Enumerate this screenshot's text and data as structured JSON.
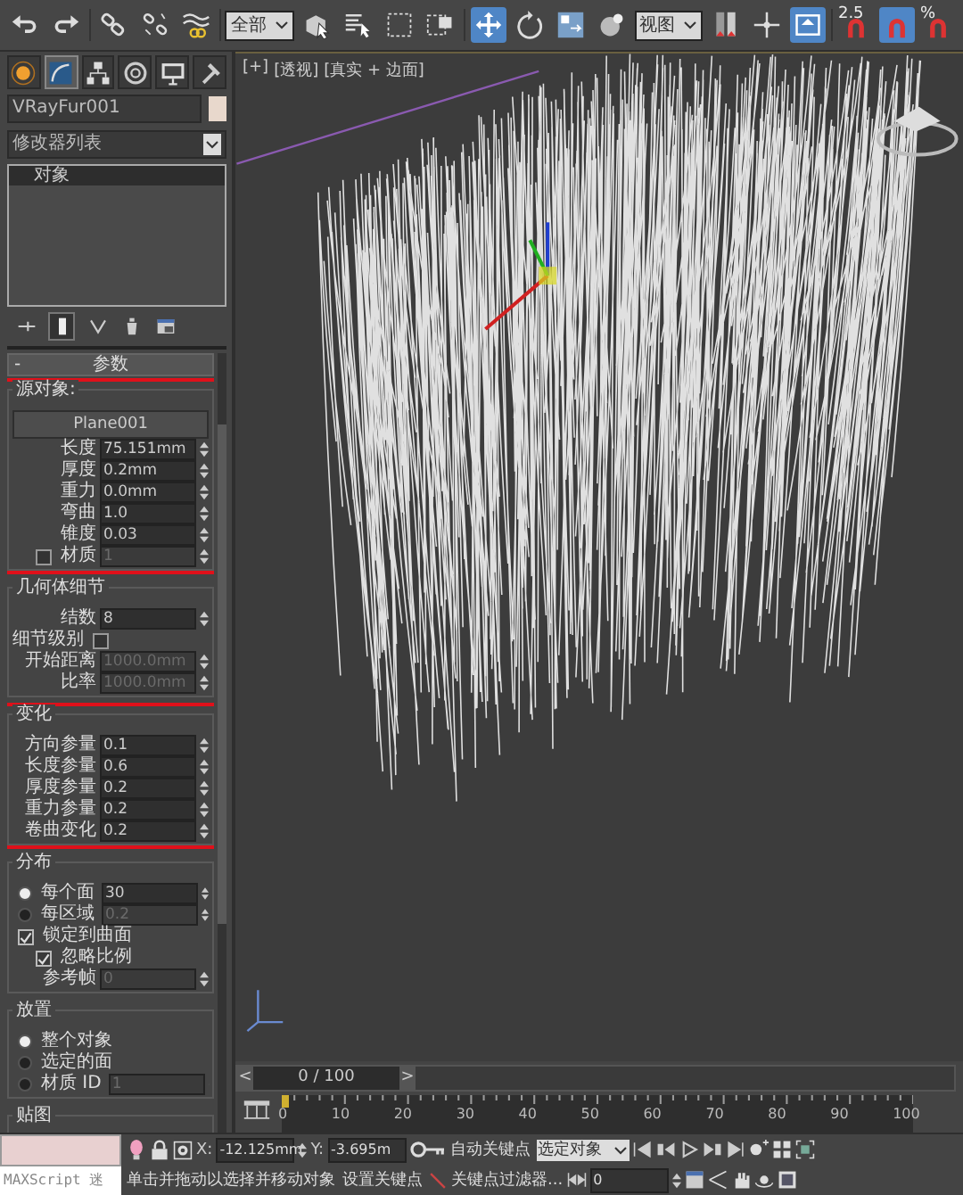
{
  "toolbar": [
    {
      "kind": "undo",
      "on": false
    },
    {
      "kind": "redo",
      "on": false
    },
    {
      "kind": "link",
      "on": false
    },
    {
      "kind": "unlink",
      "on": false
    },
    {
      "kind": "bind",
      "on": false
    },
    {
      "kind": "dropdown",
      "value": "全部"
    },
    {
      "kind": "select",
      "on": false
    },
    {
      "kind": "select-list",
      "on": false
    },
    {
      "kind": "region",
      "on": false
    },
    {
      "kind": "window",
      "on": false
    },
    {
      "kind": "move",
      "on": true
    },
    {
      "kind": "rotate",
      "on": false
    },
    {
      "kind": "scale",
      "on": false
    },
    {
      "kind": "sphere",
      "on": false
    },
    {
      "kind": "dropdown",
      "value": "视图"
    },
    {
      "kind": "mirror",
      "on": false
    },
    {
      "kind": "pivot",
      "on": false
    },
    {
      "kind": "snap",
      "on": true
    },
    {
      "kind": "magnet",
      "label": "2.5",
      "on": false
    },
    {
      "kind": "magnet",
      "on": true
    },
    {
      "kind": "magnet",
      "label": "%",
      "on": false
    }
  ],
  "command_tabs": [
    {
      "kind": "create",
      "selected": false
    },
    {
      "kind": "modify",
      "selected": true
    },
    {
      "kind": "hierarchy",
      "selected": false
    },
    {
      "kind": "motion",
      "selected": false
    },
    {
      "kind": "display",
      "selected": false
    },
    {
      "kind": "utilities",
      "selected": false
    }
  ],
  "object_name": "VRayFur001",
  "modifier_list": "修改器列表",
  "modifier_stack": [
    "对象"
  ],
  "stack_tools": [
    {
      "kind": "pin",
      "on": false
    },
    {
      "kind": "end-result",
      "on": true
    },
    {
      "kind": "unique",
      "on": false
    },
    {
      "kind": "remove",
      "on": false
    },
    {
      "kind": "configure",
      "on": false
    }
  ],
  "rollout": {
    "title": "参数",
    "collapse": "-"
  },
  "groups": [
    {
      "title": "源对象:",
      "highlighted": true,
      "rows": [
        {
          "kind": "button",
          "label": "Plane001"
        },
        {
          "kind": "spinner",
          "label": "长度",
          "value": "75.151mm",
          "disabled": false
        },
        {
          "kind": "spinner",
          "label": "厚度",
          "value": "0.2mm",
          "disabled": false
        },
        {
          "kind": "spinner",
          "label": "重力",
          "value": "0.0mm",
          "disabled": false
        },
        {
          "kind": "spinner",
          "label": "弯曲",
          "value": "1.0",
          "disabled": false
        },
        {
          "kind": "spinner",
          "label": "锥度",
          "value": "0.03",
          "disabled": false
        },
        {
          "kind": "check-spinner",
          "label": "材质",
          "value": "1",
          "checked": false,
          "disabled": true
        }
      ]
    },
    {
      "title": "几何体细节",
      "highlighted": false,
      "rows": [
        {
          "kind": "spinner",
          "label": "结数",
          "value": "8",
          "disabled": false
        },
        {
          "kind": "checkbox-right",
          "label": "细节级别",
          "checked": false
        },
        {
          "kind": "spinner",
          "label": "开始距离",
          "value": "1000.0mm",
          "disabled": true
        },
        {
          "kind": "spinner",
          "label": "比率",
          "value": "1000.0mm",
          "disabled": true
        }
      ]
    },
    {
      "title": "变化",
      "highlighted": true,
      "rows": [
        {
          "kind": "spinner",
          "label": "方向参量",
          "value": "0.1",
          "disabled": false
        },
        {
          "kind": "spinner",
          "label": "长度参量",
          "value": "0.6",
          "disabled": false
        },
        {
          "kind": "spinner",
          "label": "厚度参量",
          "value": "0.2",
          "disabled": false
        },
        {
          "kind": "spinner",
          "label": "重力参量",
          "value": "0.2",
          "disabled": false
        },
        {
          "kind": "spinner",
          "label": "卷曲变化",
          "value": "0.2",
          "disabled": false
        }
      ]
    },
    {
      "title": "分布",
      "highlighted": false,
      "rows": [
        {
          "kind": "radio-spinner",
          "label": "每个面",
          "value": "30",
          "selected": true,
          "disabled": false
        },
        {
          "kind": "radio-spinner",
          "label": "每区域",
          "value": "0.2",
          "selected": false,
          "disabled": true
        },
        {
          "kind": "checkbox",
          "label": "锁定到曲面",
          "checked": true,
          "indent": false
        },
        {
          "kind": "checkbox",
          "label": "忽略比例",
          "checked": true,
          "indent": true
        },
        {
          "kind": "spinner",
          "label": "参考帧",
          "value": "0",
          "disabled": true
        }
      ]
    },
    {
      "title": "放置",
      "highlighted": false,
      "rows": [
        {
          "kind": "radio",
          "label": "整个对象",
          "selected": true
        },
        {
          "kind": "radio",
          "label": "选定的面",
          "selected": false
        },
        {
          "kind": "radio-spinner",
          "label": "材质 ID",
          "value": "1",
          "selected": false,
          "disabled": true
        }
      ]
    },
    {
      "title": "贴图",
      "highlighted": false
    }
  ],
  "viewport": {
    "labels": [
      "[+]",
      "[透视]",
      "[真实 + 边面]"
    ]
  },
  "time_slider": {
    "prev": "<",
    "position": "0 / 100",
    "next": ">",
    "level": 0
  },
  "track_ticks": [
    "0",
    "10",
    "20",
    "30",
    "40",
    "50",
    "60",
    "70",
    "80",
    "90",
    "100"
  ],
  "status_bar": {
    "maxscript": "MAXScript 迷",
    "prompt": "单击并拖动以选择并移动对象",
    "x_label": "X:",
    "x": "-12.125mm",
    "y_label": "Y:",
    "y": "-3.695m",
    "auto_key": "自动关键点",
    "key_mode": "选定对象",
    "set_key": "设置关键点",
    "key_filters": "关键点过滤器...",
    "frame": "0"
  }
}
